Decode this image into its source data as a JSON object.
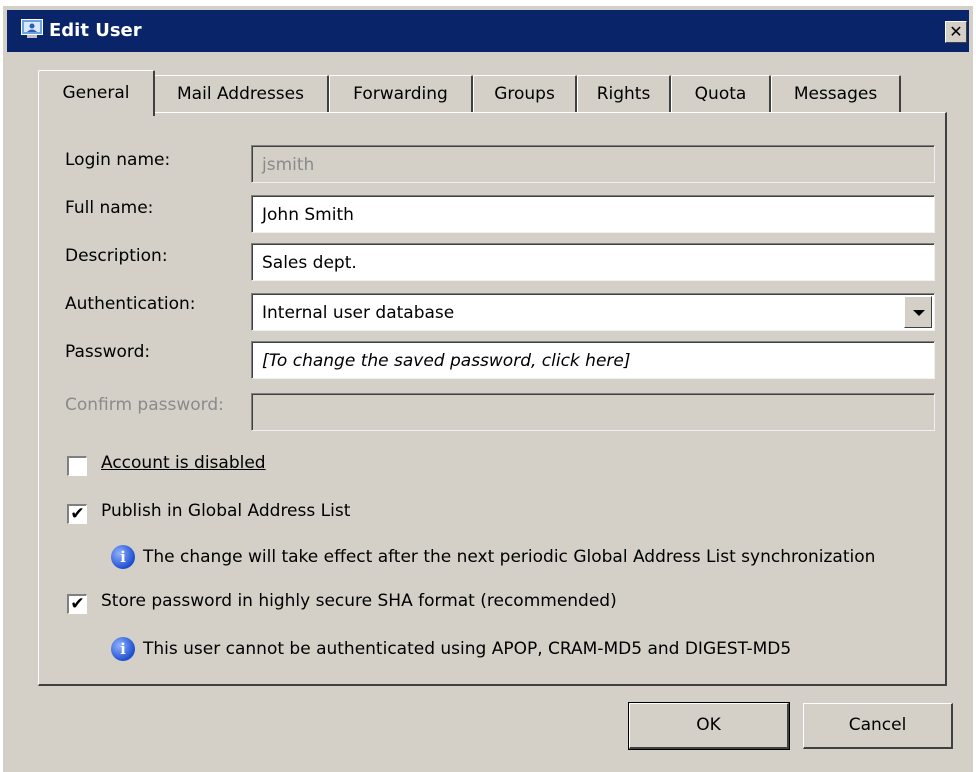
{
  "window": {
    "title": "Edit User",
    "close_label": "✕"
  },
  "tabs": [
    {
      "label": "General",
      "active": true
    },
    {
      "label": "Mail Addresses",
      "active": false
    },
    {
      "label": "Forwarding",
      "active": false
    },
    {
      "label": "Groups",
      "active": false
    },
    {
      "label": "Rights",
      "active": false
    },
    {
      "label": "Quota",
      "active": false
    },
    {
      "label": "Messages",
      "active": false
    }
  ],
  "form": {
    "login_name": {
      "label": "Login name:",
      "value": "jsmith"
    },
    "full_name": {
      "label": "Full name:",
      "value": "John Smith"
    },
    "description": {
      "label": "Description:",
      "value": "Sales dept."
    },
    "authentication": {
      "label": "Authentication:",
      "value": "Internal user database"
    },
    "password": {
      "label": "Password:",
      "value": "[To change the saved password, click here]"
    },
    "confirm_password": {
      "label": "Confirm password:",
      "value": ""
    }
  },
  "options": {
    "account_disabled": {
      "label": "Account is disabled",
      "checked": false
    },
    "publish_gal": {
      "label": "Publish in Global Address List",
      "checked": true
    },
    "publish_gal_info": "The change will take effect after the next periodic Global Address List synchronization",
    "store_sha": {
      "label": "Store password in highly secure SHA format (recommended)",
      "checked": true
    },
    "store_sha_info": "This user cannot be authenticated using APOP, CRAM-MD5 and DIGEST-MD5"
  },
  "buttons": {
    "ok": "OK",
    "cancel": "Cancel"
  },
  "icons": {
    "app": "user-edit-icon",
    "info": "info-icon",
    "check": "✔"
  },
  "colors": {
    "titlebar": "#0a246a",
    "face": "#d4d0c8",
    "info_blue": "#1f4fcf"
  }
}
